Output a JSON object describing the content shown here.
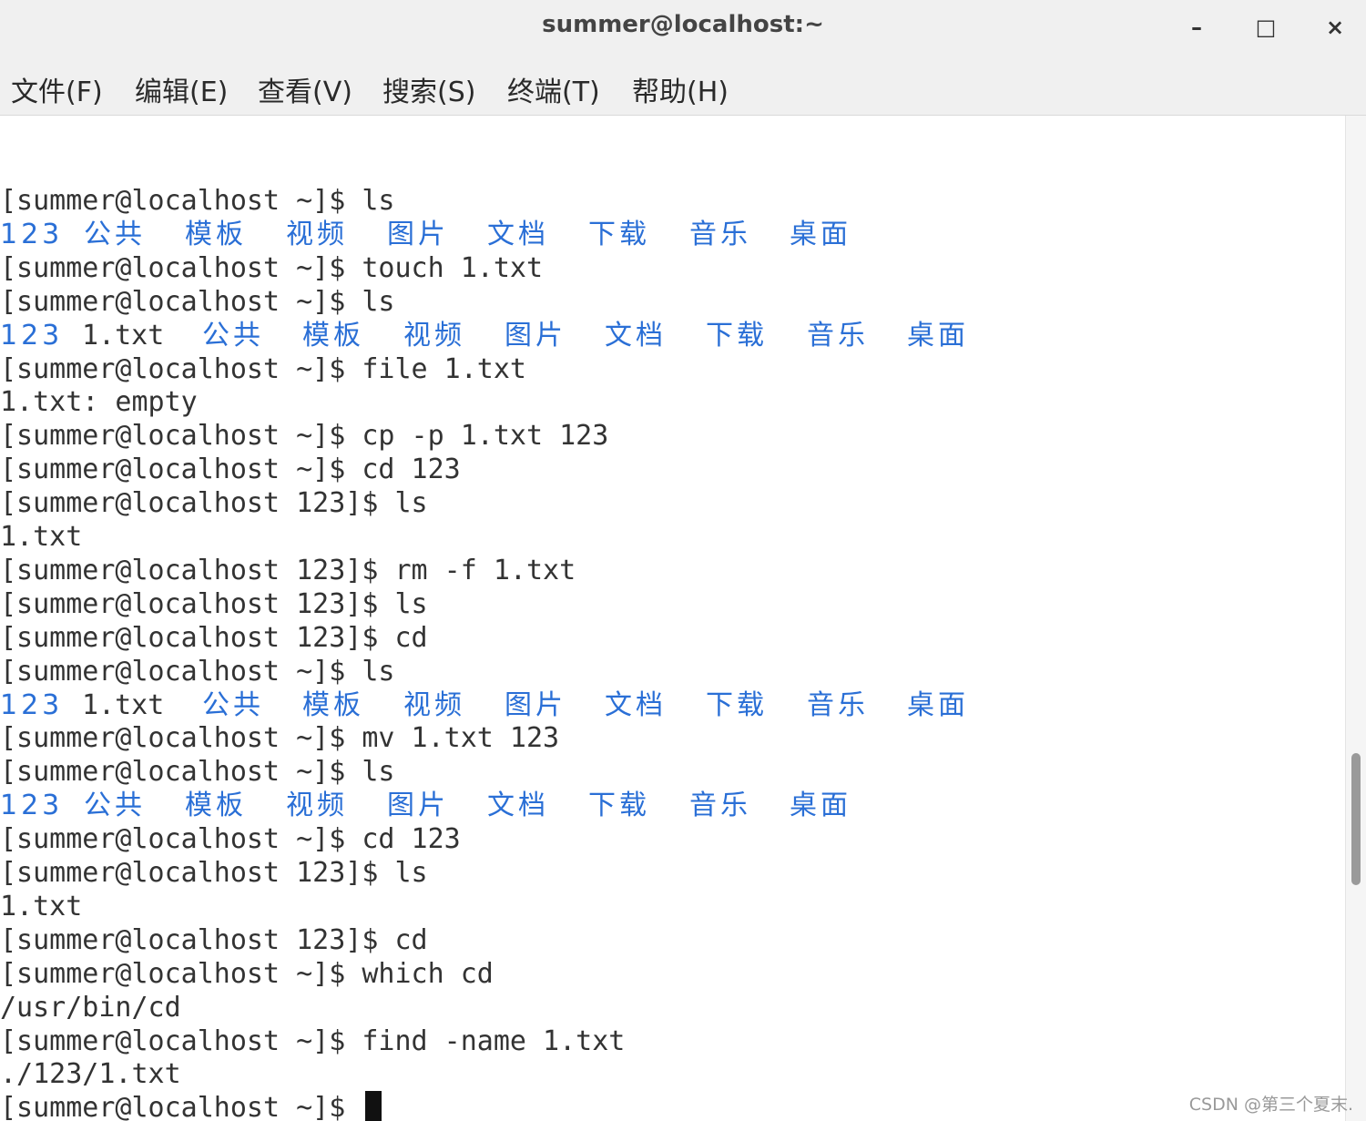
{
  "window": {
    "title": "summer@localhost:~",
    "minimize": "–",
    "maximize": "□",
    "close": "×"
  },
  "menu": [
    "文件(F)",
    "编辑(E)",
    "查看(V)",
    "搜索(S)",
    "终端(T)",
    "帮助(H)"
  ],
  "terminal": {
    "lines": [
      {
        "kind": "text",
        "text": "[summer@localhost ~]$ ls"
      },
      {
        "kind": "dirs",
        "items": [
          "123",
          "公共",
          "模板",
          "视频",
          "图片",
          "文档",
          "下载",
          "音乐",
          "桌面"
        ]
      },
      {
        "kind": "text",
        "text": "[summer@localhost ~]$ touch 1.txt"
      },
      {
        "kind": "text",
        "text": "[summer@localhost ~]$ ls"
      },
      {
        "kind": "dirs",
        "items": [
          "123",
          "1.txt",
          "公共",
          "模板",
          "视频",
          "图片",
          "文档",
          "下载",
          "音乐",
          "桌面"
        ]
      },
      {
        "kind": "text",
        "text": "[summer@localhost ~]$ file 1.txt"
      },
      {
        "kind": "text",
        "text": "1.txt: empty"
      },
      {
        "kind": "text",
        "text": "[summer@localhost ~]$ cp -p 1.txt 123"
      },
      {
        "kind": "text",
        "text": "[summer@localhost ~]$ cd 123"
      },
      {
        "kind": "text",
        "text": "[summer@localhost 123]$ ls"
      },
      {
        "kind": "text",
        "text": "1.txt"
      },
      {
        "kind": "text",
        "text": "[summer@localhost 123]$ rm -f 1.txt"
      },
      {
        "kind": "text",
        "text": "[summer@localhost 123]$ ls"
      },
      {
        "kind": "text",
        "text": "[summer@localhost 123]$ cd"
      },
      {
        "kind": "text",
        "text": "[summer@localhost ~]$ ls"
      },
      {
        "kind": "dirs",
        "items": [
          "123",
          "1.txt",
          "公共",
          "模板",
          "视频",
          "图片",
          "文档",
          "下载",
          "音乐",
          "桌面"
        ]
      },
      {
        "kind": "text",
        "text": "[summer@localhost ~]$ mv 1.txt 123"
      },
      {
        "kind": "text",
        "text": "[summer@localhost ~]$ ls"
      },
      {
        "kind": "dirs",
        "items": [
          "123",
          "公共",
          "模板",
          "视频",
          "图片",
          "文档",
          "下载",
          "音乐",
          "桌面"
        ]
      },
      {
        "kind": "text",
        "text": "[summer@localhost ~]$ cd 123"
      },
      {
        "kind": "text",
        "text": "[summer@localhost 123]$ ls"
      },
      {
        "kind": "text",
        "text": "1.txt"
      },
      {
        "kind": "text",
        "text": "[summer@localhost 123]$ cd"
      },
      {
        "kind": "text",
        "text": "[summer@localhost ~]$ which cd"
      },
      {
        "kind": "text",
        "text": "/usr/bin/cd"
      },
      {
        "kind": "text",
        "text": "[summer@localhost ~]$ find -name 1.txt"
      },
      {
        "kind": "text",
        "text": "./123/1.txt"
      },
      {
        "kind": "prompt",
        "text": "[summer@localhost ~]$ "
      }
    ]
  },
  "watermark": "CSDN @第三个夏末.",
  "colors": {
    "directory": "#2a6fd6",
    "text": "#333333",
    "chrome": "#f0f0f0"
  }
}
